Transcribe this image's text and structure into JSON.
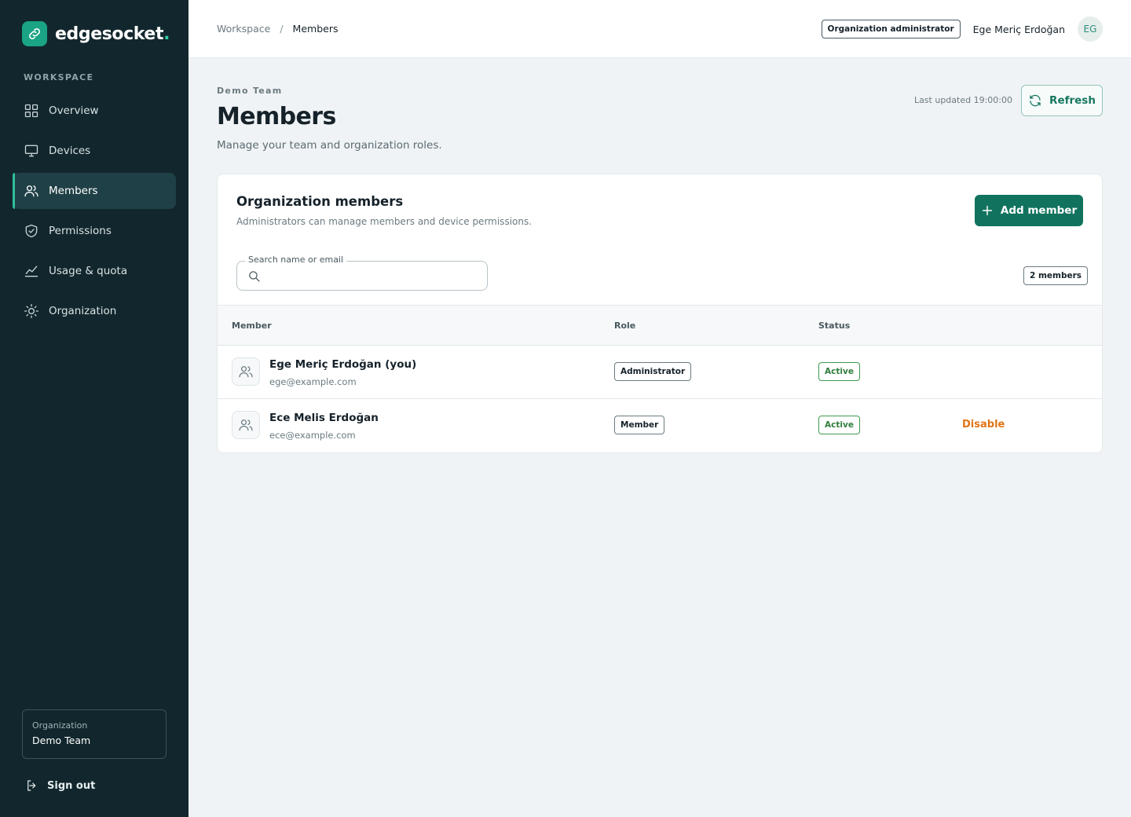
{
  "brand": {
    "name": "edgesocket",
    "dot": "."
  },
  "sidebar": {
    "section_label": "WORKSPACE",
    "items": [
      {
        "label": "Overview",
        "icon": "grid-icon"
      },
      {
        "label": "Devices",
        "icon": "monitor-icon"
      },
      {
        "label": "Members",
        "icon": "users-icon",
        "active": true
      },
      {
        "label": "Permissions",
        "icon": "shield-check-icon"
      },
      {
        "label": "Usage & quota",
        "icon": "line-chart-icon"
      },
      {
        "label": "Organization",
        "icon": "sun-icon"
      }
    ],
    "organization_label": "Organization",
    "organization_value": "Demo Team",
    "signout_label": "Sign out"
  },
  "header": {
    "breadcrumb": [
      "Workspace",
      "Members"
    ],
    "breadcrumb_sep": "/",
    "role_chip": "Organization administrator",
    "user_name": "Ege Meriç Erdoğan",
    "user_initials": "EG"
  },
  "page": {
    "eyebrow": "Demo Team",
    "title": "Members",
    "subtitle": "Manage your team and organization roles.",
    "last_updated": "Last updated 19:00:00",
    "refresh_label": "Refresh"
  },
  "card": {
    "title": "Organization members",
    "subtitle": "Administrators can manage members and device permissions.",
    "add_label": "Add member",
    "search_label": "Search name or email",
    "search_value": "",
    "count_label": "2 members",
    "columns": [
      "Member",
      "Role",
      "Status"
    ],
    "rows": [
      {
        "name": "Ege Meriç Erdoğan (you)",
        "email": "ege@example.com",
        "role": "Administrator",
        "status": "Active",
        "action": ""
      },
      {
        "name": "Ece Melis Erdoğan",
        "email": "ece@example.com",
        "role": "Member",
        "status": "Active",
        "action": "Disable"
      }
    ]
  },
  "colors": {
    "sidebar_bg": "#12272d",
    "accent": "#11735e",
    "status_active": "#2e7d3c",
    "danger_action": "#e07415"
  }
}
